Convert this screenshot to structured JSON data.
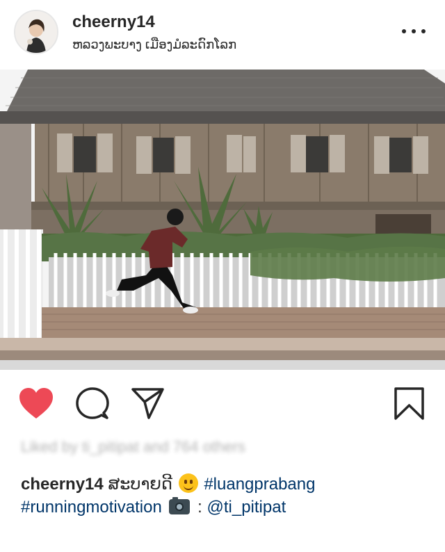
{
  "header": {
    "username": "cheerny14",
    "location": "ຫລວງພະບາງ ເມືອງມໍລະດົກໂລກ"
  },
  "likes": {
    "text": "Liked by ti_pitipat and 764 others"
  },
  "caption": {
    "username": "cheerny14",
    "text_lao": "ສະບາຍດີ",
    "tag_1": "#luangprabang",
    "tag_2": "#runningmotivation",
    "separator": ":",
    "mention": "@ti_pitipat",
    "emoji_1": "smiling-face-emoji",
    "emoji_2": "camera-emoji"
  },
  "icons": {
    "like": "heart-icon",
    "comment": "comment-icon",
    "share": "direct-share-icon",
    "save": "bookmark-icon",
    "more": "more-options-icon"
  },
  "colors": {
    "heart": "#ed4956",
    "hashtag": "#003569",
    "text": "#262626"
  }
}
